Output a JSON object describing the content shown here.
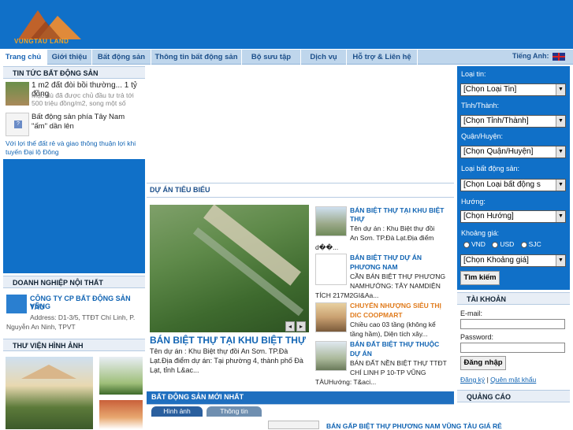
{
  "header": {
    "logo_text": "VUNGTAU LAND"
  },
  "nav": {
    "items": [
      "Trang chủ",
      "Giới thiệu",
      "Bất động sản",
      "Thông tin bất động sản",
      "Bộ sưu tập",
      "Dịch vụ",
      "Hỗ trợ & Liên hệ"
    ],
    "language_label": "Tiếng Anh:"
  },
  "news": {
    "title": "TIN TỨC BẤT ĐỘNG SẢN",
    "item1_title": "1 m2 đất đòi bồi thường... 1 tỷ đồng",
    "item1_desc": "Mặc dù đã được chủ đầu tư trả tới 500 triệu đồng/m2, song một số",
    "item2_title": "Bất động sản phía Tây Nam \"ấm\" dần lên",
    "item3_line1": "Với lợi thế đất rẻ và giao thông thuận lợi khi",
    "item3_line2": "tuyến Đại lộ Đông"
  },
  "company": {
    "section_title": "DOANH NGHIỆP NỘI THẤT",
    "name_line1": "CÔNG TY CP BẤT ĐỘNG SẢN VŨNG",
    "name_line2": "TÀU",
    "address_line1": "Address: D1-3/5, TTĐT Chí Linh, P.",
    "address_line2": "Nguyễn An Ninh, TPVT"
  },
  "gallery": {
    "title": "THƯ VIỆN HÌNH ẢNH"
  },
  "projects": {
    "title": "DỰ ÁN TIÊU BIỂU",
    "featured_title": "BÁN BIỆT THỰ TẠI KHU BIỆT THỰ",
    "featured_desc1": "Tên dự án : Khu Biệt thự đồi An Sơn. TP.Đà",
    "featured_desc2": "Lạt.Địa điểm dự án: Tại phường 4, thành phố Đà",
    "featured_desc3": "Lạt, tỉnh L&ac...",
    "list": [
      {
        "t1": "BÁN BIỆT THỰ TẠI KHU BIỆT",
        "t2": "THỰ",
        "d1": "Tên dự án : Khu Biệt thự đồi",
        "d2": "An Sơn. TP.Đà Lạt.Địa điểm",
        "d3": "d��..."
      },
      {
        "t1": "BÁN BIỆT THỰ DỰ ÁN",
        "t2": "PHƯƠNG NAM",
        "d1": "CẦN BÁN BIỆT THỰ PHƯƠNG",
        "d2": "NAMHƯỚNG: TÂY NAMDIỆN",
        "d3": "TÍCH 217M2GI&Aa..."
      },
      {
        "t1": "CHUYỂN NHƯỢNG SIÊU THỊ",
        "t2": "DIC COOPMART",
        "d1": "Chiều cao 03 tầng (không kể",
        "d2": "tầng hầm), Diện tích xây...",
        "d3": ""
      },
      {
        "t1": "BÁN ĐẤT BIỆT THỰ THUỘC",
        "t2": "DỰ ÁN",
        "d1": "BÁN ĐẤT NỀN BIỆT THỰ TTĐT",
        "d2": "CHÍ LINH P 10-TP VŨNG",
        "d3": "TÀUHướng: T&aci..."
      }
    ]
  },
  "newest": {
    "title": "BẤT ĐỘNG SẢN MỚI NHẤT",
    "tab1": "Hình ảnh",
    "tab2": "Thông tin",
    "item_title": "BÁN GẤP BIỆT THỰ PHƯƠNG NAM VŨNG TÀU GIÁ RẺ"
  },
  "search": {
    "loai_tin_label": "Loại tin:",
    "loai_tin_value": "[Chọn Loại Tin]",
    "tinh_label": "Tỉnh/Thành:",
    "tinh_value": "[Chọn Tỉnh/Thành]",
    "quan_label": "Quận/Huyện:",
    "quan_value": "[Chọn Quận/Huyện]",
    "loai_bds_label": "Loại bất động sản:",
    "loai_bds_value": "[Chọn Loại bất động s",
    "huong_label": "Hướng:",
    "huong_value": "[Chọn Hướng]",
    "gia_label": "Khoảng giá:",
    "currencies": [
      "VND",
      "USD",
      "SJC"
    ],
    "gia_value": "[Chọn Khoảng giá]",
    "submit": "Tìm kiếm"
  },
  "account": {
    "title": "TÀI KHOẢN",
    "email_label": "E-mail:",
    "password_label": "Password:",
    "login_button": "Đăng nhập",
    "register": "Đăng ký",
    "separator": "|",
    "forgot": "Quên mật khẩu"
  },
  "ads": {
    "title": "QUẢNG CÁO"
  },
  "colors": {
    "header_blue": "#1070c8",
    "nav_bg": "#bfd6ec",
    "link": "#1164b3",
    "orange": "#f6a623"
  }
}
